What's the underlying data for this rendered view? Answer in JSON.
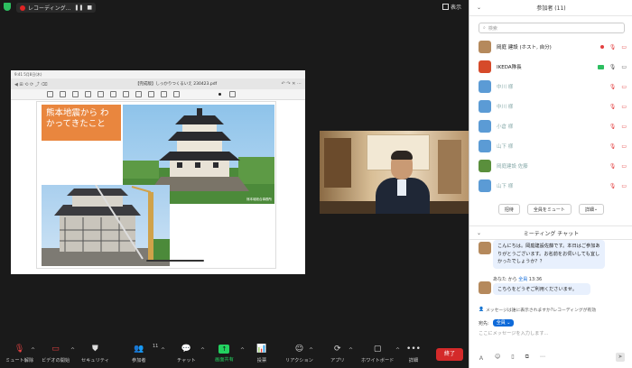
{
  "recording": {
    "label": "レコーディング...",
    "pause_icon": "pause-icon",
    "stop_icon": "stop-icon"
  },
  "view": {
    "label": "表示"
  },
  "share": {
    "status_left": "9:41  5月8日(木)",
    "doc_title": "【完成版】しっかりつくるいえ 230423.pdf",
    "nav_left": "◀  ⊞  ⟲  ⟳  ⤴  ⌫",
    "nav_right": "↶  ↷  ✕  ⋯",
    "slide_title": "熊本地震から わかってきたこと",
    "photo_credit": "熊本城総合事務所"
  },
  "toolbar": {
    "mute": "ミュート解除",
    "video": "ビデオの開始",
    "security": "セキュリティ",
    "participants": "参加者",
    "participants_count": "11",
    "chat": "チャット",
    "share": "画面共有",
    "poll": "投票",
    "reactions": "リアクション",
    "apps": "アプリ",
    "whiteboard": "ホワイトボード",
    "more": "詳細",
    "end": "終了"
  },
  "participants": {
    "header": "参加者 (11)",
    "search_placeholder": "検索",
    "rows": [
      {
        "name": "岡庭 建設 (ホスト, 自分)",
        "avatar_color": "#b5895c"
      },
      {
        "name": "IKEDA隊長",
        "avatar_color": "#d64a2a"
      },
      {
        "name": "中川 様",
        "avatar_color": "#5b9bd5"
      },
      {
        "name": "中川 様",
        "avatar_color": "#5b9bd5"
      },
      {
        "name": "小倉 様",
        "avatar_color": "#5b9bd5"
      },
      {
        "name": "山下 様",
        "avatar_color": "#5b9bd5"
      },
      {
        "name": "岡庭建設 佐藤",
        "avatar_color": "#5a8f3c"
      },
      {
        "name": "山下 様",
        "avatar_color": "#5b9bd5"
      }
    ],
    "invite": "招待",
    "mute_all": "全員をミュート",
    "more": "詳細"
  },
  "chat": {
    "header": "ミーティング チャット",
    "message1": "こんにちは。岡庭建設佐藤です。本日はご参加ありがとうございます。お名前をお伺いしても宜しかったでしょうか？？",
    "meta_from": "あなた から",
    "meta_to": "全員",
    "meta_time": "13:36",
    "message2": "こちらをどうぞご利用くださいませ。",
    "notice": "メッセージは誰に表示されますか?レコーディングが有効",
    "to_label": "宛先:",
    "to_value": "全員",
    "input_placeholder": "ここにメッセージを入力します..."
  },
  "colors": {
    "accent": "#0e6ad9",
    "share_green": "#23d160",
    "end_red": "#d42a2a",
    "slide_orange": "#e9863e"
  }
}
